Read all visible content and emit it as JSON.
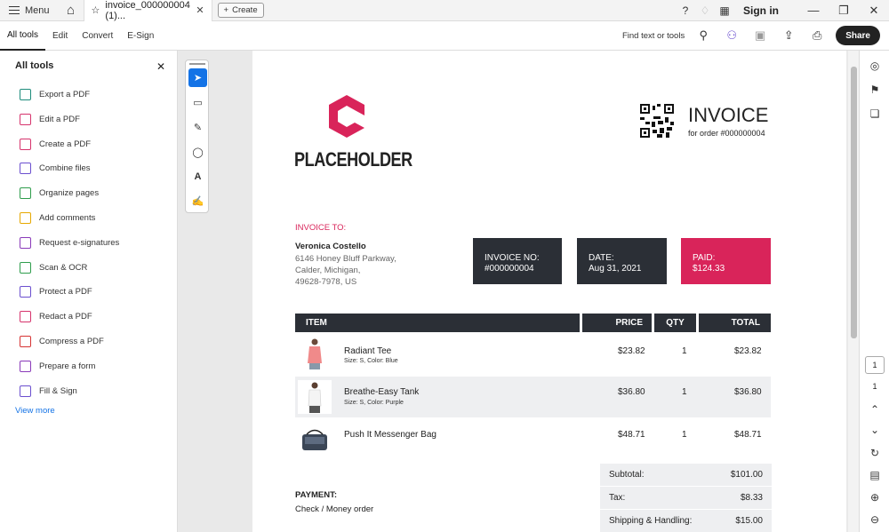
{
  "titlebar": {
    "menu": "Menu",
    "tab_title": "invoice_000000004 (1)...",
    "close": "✕",
    "create": "Create",
    "signin": "Sign in"
  },
  "toolbar": {
    "items": [
      "All tools",
      "Edit",
      "Convert",
      "E-Sign"
    ],
    "find": "Find text or tools",
    "share": "Share"
  },
  "sidebar": {
    "title": "All tools",
    "tools": [
      {
        "label": "Export a PDF",
        "color": "#1e8c7c"
      },
      {
        "label": "Edit a PDF",
        "color": "#d6336c"
      },
      {
        "label": "Create a PDF",
        "color": "#d6336c"
      },
      {
        "label": "Combine files",
        "color": "#6b4fcf"
      },
      {
        "label": "Organize pages",
        "color": "#2e9d4c"
      },
      {
        "label": "Add comments",
        "color": "#e6a800"
      },
      {
        "label": "Request e-signatures",
        "color": "#8a3ab9"
      },
      {
        "label": "Scan & OCR",
        "color": "#2e9d4c"
      },
      {
        "label": "Protect a PDF",
        "color": "#6b4fcf"
      },
      {
        "label": "Redact a PDF",
        "color": "#d6336c"
      },
      {
        "label": "Compress a PDF",
        "color": "#d63333"
      },
      {
        "label": "Prepare a form",
        "color": "#8a3ab9"
      },
      {
        "label": "Fill & Sign",
        "color": "#6b4fcf"
      }
    ],
    "view_more": "View more"
  },
  "invoice": {
    "brand": "PLACEHOLDER",
    "title": "INVOICE",
    "order_line": "for order #000000004",
    "to_label": "INVOICE TO:",
    "customer_name": "Veronica Costello",
    "address": [
      "6146 Honey Bluff Parkway,",
      "Calder, Michigan,",
      "49628-7978, US"
    ],
    "boxes": [
      {
        "label": "INVOICE NO:",
        "value": "#000000004"
      },
      {
        "label": "DATE:",
        "value": "Aug 31, 2021"
      },
      {
        "label": "PAID:",
        "value": "$124.33"
      }
    ],
    "headers": {
      "item": "ITEM",
      "price": "PRICE",
      "qty": "QTY",
      "total": "TOTAL"
    },
    "items": [
      {
        "name": "Radiant Tee",
        "options": "Size: S, Color: Blue",
        "price": "$23.82",
        "qty": "1",
        "total": "$23.82"
      },
      {
        "name": "Breathe-Easy Tank",
        "options": "Size: S, Color: Purple",
        "price": "$36.80",
        "qty": "1",
        "total": "$36.80"
      },
      {
        "name": "Push It Messenger Bag",
        "options": "",
        "price": "$48.71",
        "qty": "1",
        "total": "$48.71"
      }
    ],
    "payment_label": "PAYMENT:",
    "payment_method": "Check / Money order",
    "totals": [
      {
        "label": "Subtotal:",
        "value": "$101.00"
      },
      {
        "label": "Tax:",
        "value": "$8.33"
      },
      {
        "label": "Shipping & Handling:",
        "value": "$15.00"
      }
    ]
  },
  "page_nav": {
    "current": "1",
    "total": "1"
  },
  "colors": {
    "accent": "#d9245a",
    "dark": "#2b2f36",
    "blue": "#1473e6"
  }
}
